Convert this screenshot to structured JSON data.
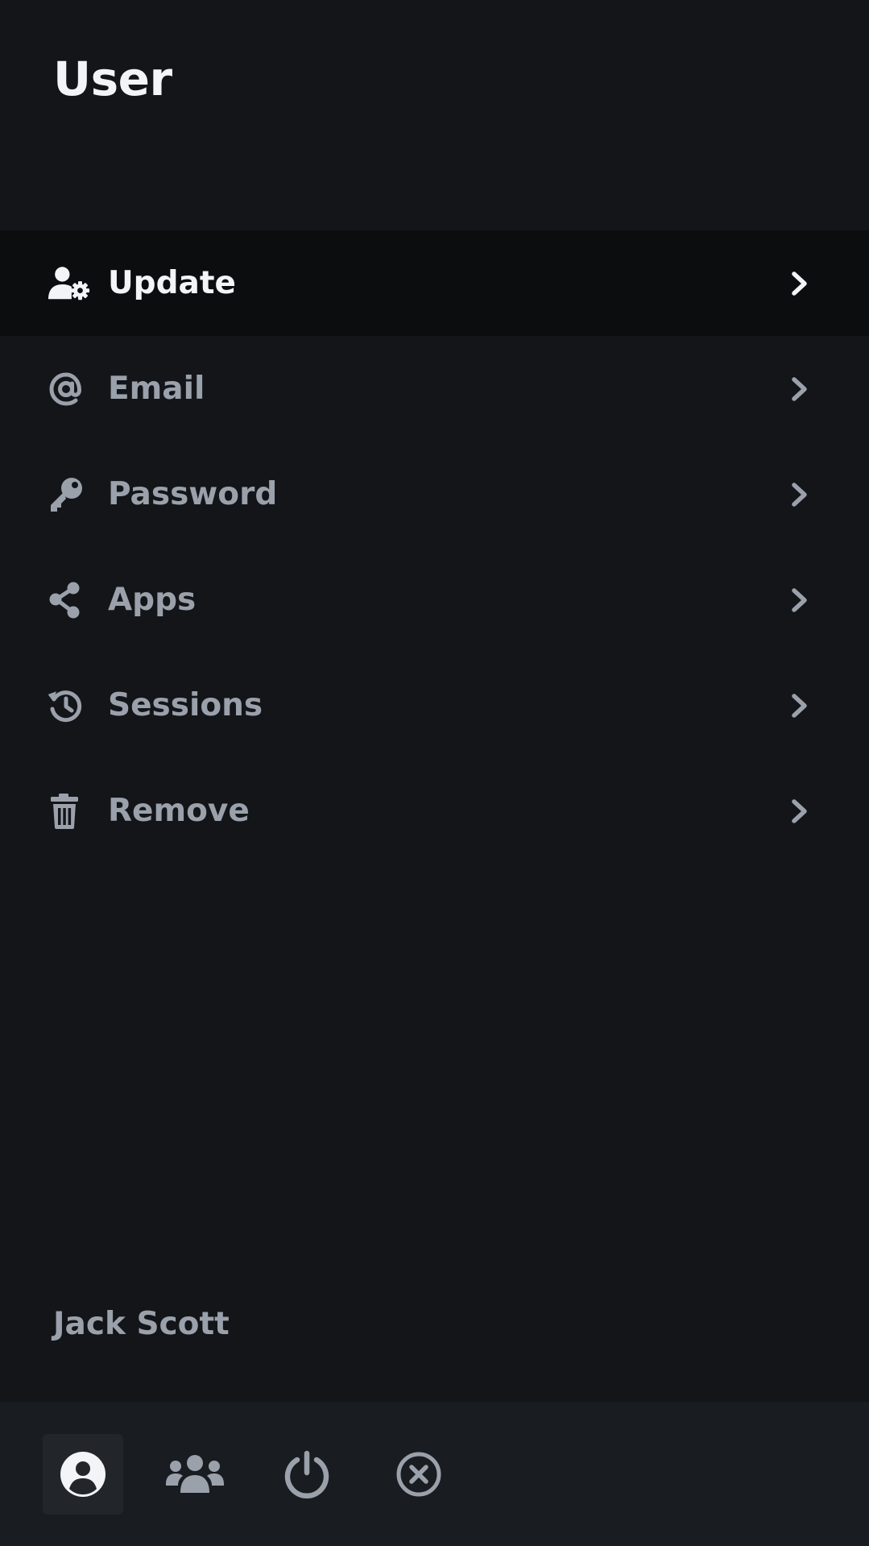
{
  "header": {
    "title": "User"
  },
  "menu": {
    "items": [
      {
        "label": "Update",
        "icon": "user-gear-icon",
        "active": true
      },
      {
        "label": "Email",
        "icon": "at-icon",
        "active": false
      },
      {
        "label": "Password",
        "icon": "key-icon",
        "active": false
      },
      {
        "label": "Apps",
        "icon": "share-icon",
        "active": false
      },
      {
        "label": "Sessions",
        "icon": "history-icon",
        "active": false
      },
      {
        "label": "Remove",
        "icon": "trash-icon",
        "active": false
      }
    ]
  },
  "footer": {
    "username": "Jack Scott"
  },
  "bottom_nav": {
    "items": [
      {
        "icon": "user-circle-icon",
        "active": true
      },
      {
        "icon": "users-icon",
        "active": false
      },
      {
        "icon": "power-icon",
        "active": false
      },
      {
        "icon": "close-circle-icon",
        "active": false
      }
    ]
  },
  "colors": {
    "background": "#131519",
    "active_row": "#0c0d0f",
    "bottom_bar": "#191c20",
    "text_active": "#f2f4f7",
    "text_muted": "#9aa1ab"
  }
}
